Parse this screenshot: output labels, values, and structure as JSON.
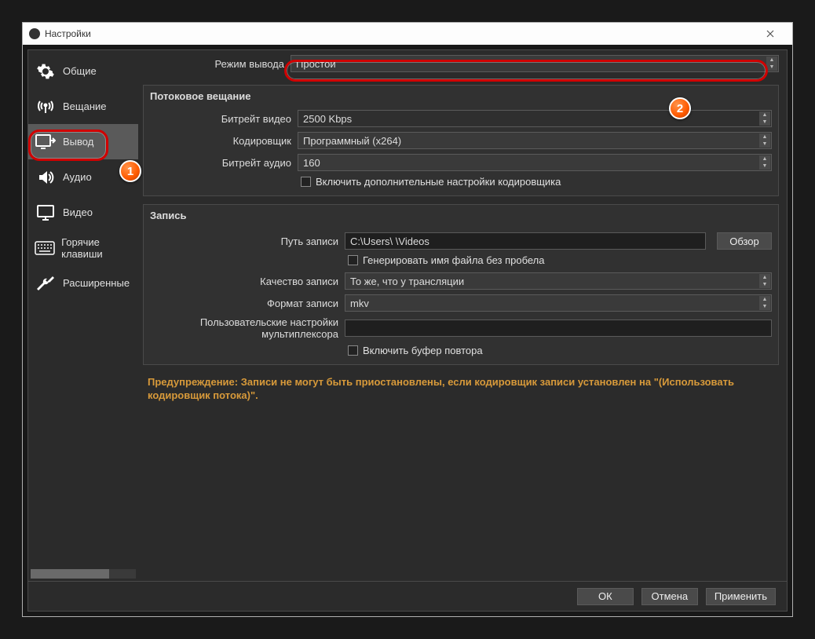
{
  "window": {
    "title": "Настройки"
  },
  "sidebar": {
    "items": [
      {
        "label": "Общие"
      },
      {
        "label": "Вещание"
      },
      {
        "label": "Вывод"
      },
      {
        "label": "Аудио"
      },
      {
        "label": "Видео"
      },
      {
        "label": "Горячие клавиши"
      },
      {
        "label": "Расширенные"
      }
    ]
  },
  "outputMode": {
    "label": "Режим вывода",
    "value": "Простой"
  },
  "streaming": {
    "title": "Потоковое вещание",
    "videoBitrate": {
      "label": "Битрейт видео",
      "value": "2500 Kbps"
    },
    "encoder": {
      "label": "Кодировщик",
      "value": "Программный (x264)"
    },
    "audioBitrate": {
      "label": "Битрейт аудио",
      "value": "160"
    },
    "advancedCheckbox": "Включить дополнительные настройки кодировщика"
  },
  "recording": {
    "title": "Запись",
    "path": {
      "label": "Путь записи",
      "value": "C:\\Users\\               \\Videos"
    },
    "browse": "Обзор",
    "noSpace": "Генерировать имя файла без пробела",
    "quality": {
      "label": "Качество записи",
      "value": "То же, что у трансляции"
    },
    "format": {
      "label": "Формат записи",
      "value": "mkv"
    },
    "muxer": {
      "label": "Пользовательские настройки мультиплексора",
      "value": ""
    },
    "replayBuffer": "Включить буфер повтора"
  },
  "warning": "Предупреждение: Записи не могут быть приостановлены, если кодировщик записи установлен на \"(Использовать кодировщик потока)\".",
  "buttons": {
    "ok": "ОК",
    "cancel": "Отмена",
    "apply": "Применить"
  },
  "badges": {
    "one": "1",
    "two": "2"
  }
}
